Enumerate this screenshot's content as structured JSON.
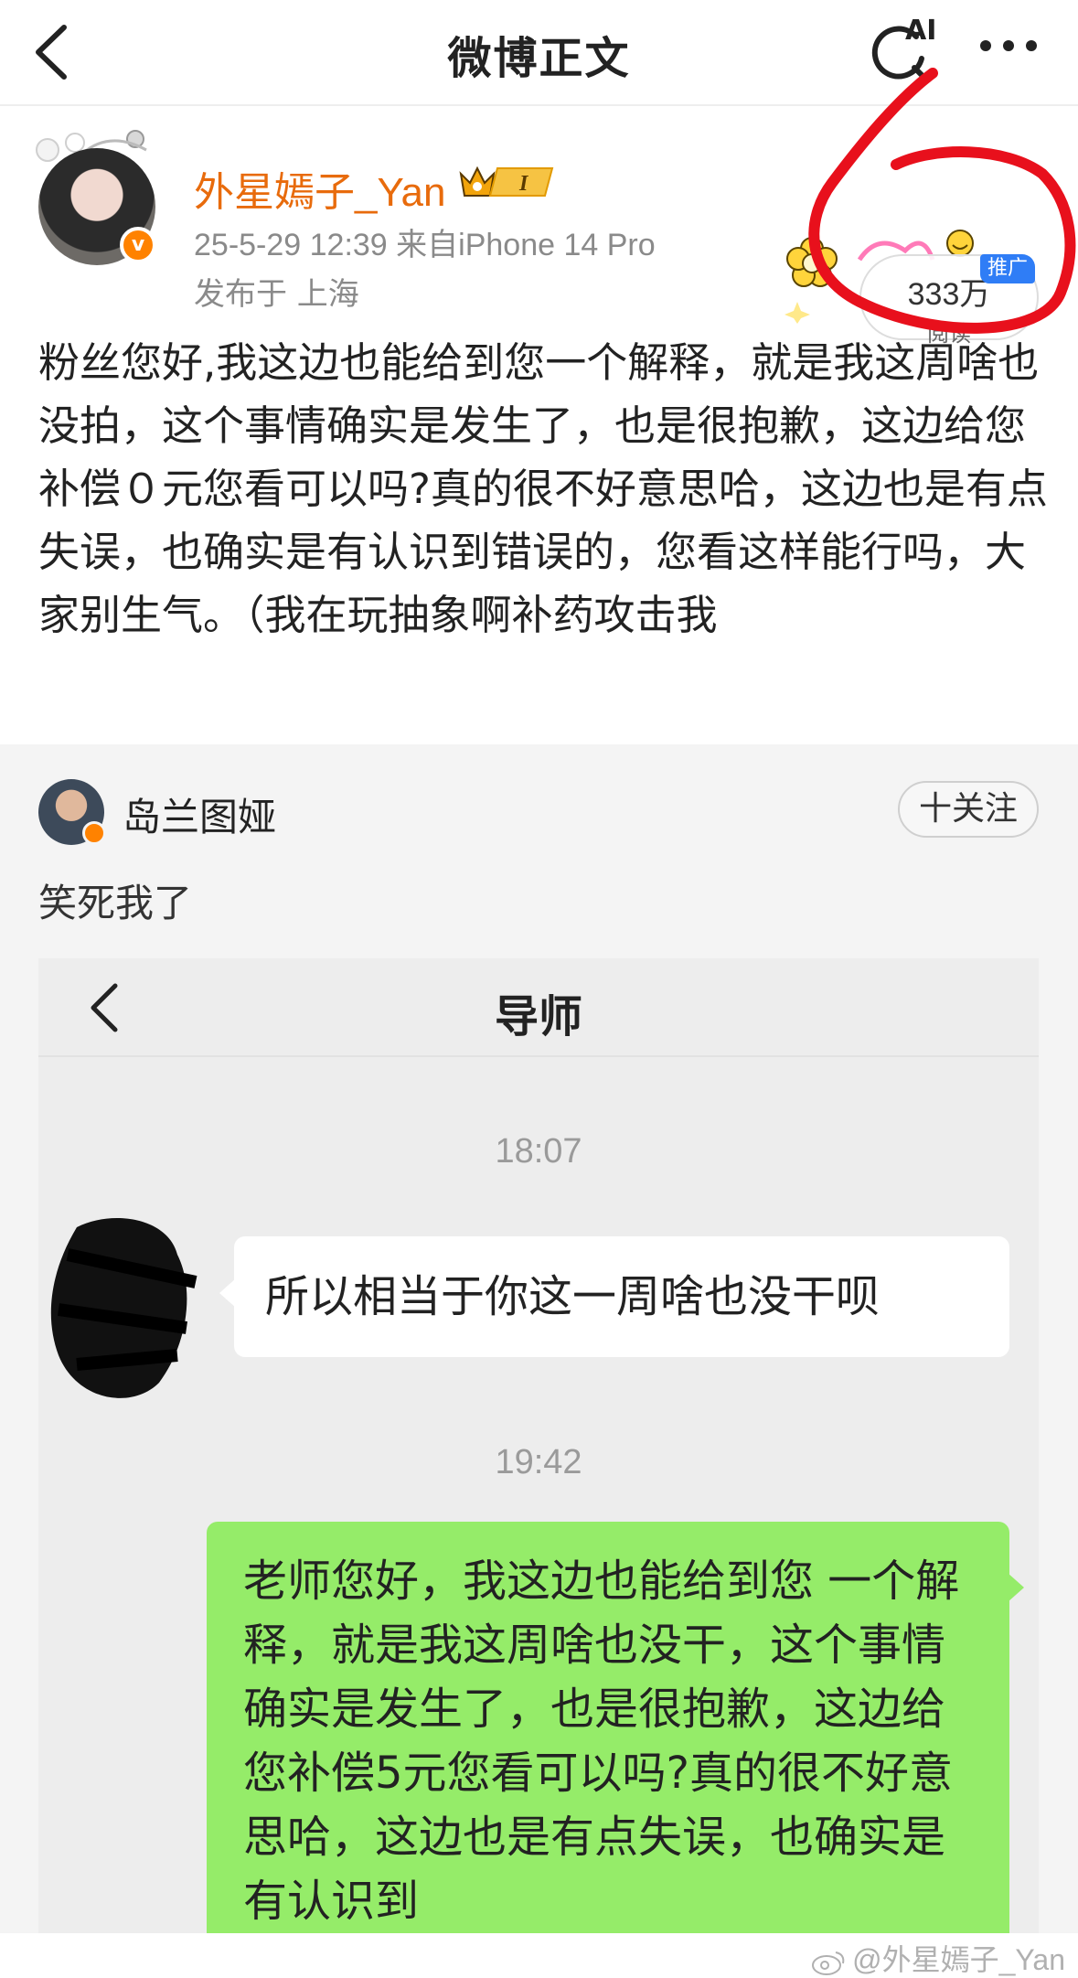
{
  "nav": {
    "title": "微博正文",
    "ai_label": "AI"
  },
  "post": {
    "username": "外星嫣子_Yan",
    "vip_level": "I",
    "meta": "25-5-29 12:39  来自iPhone 14 Pro",
    "location": "发布于 上海",
    "read_count": "333万",
    "read_label": "阅读",
    "promo_tag": "推广",
    "body": "粉丝您好,我这边也能给到您一个解释，就是我这周啥也没拍，这个事情确实是发生了，也是很抱歉，这边给您补偿０元您看可以吗?真的很不好意思哈，这边也是有点失误，也确实是有认识到错误的，您看这样能行吗，大家别生气。（我在玩抽象啊补药攻击我"
  },
  "repost": {
    "username": "岛兰图娅",
    "follow_label": "十关注",
    "text": "笑死我了",
    "chat": {
      "title": "导师",
      "time1": "18:07",
      "message1": "所以相当于你这一周啥也没干呗",
      "time2": "19:42",
      "message2": "老师您好，我这边也能给到您 一个解释，就是我这周啥也没干，这个事情确实是发生了，也是很抱歉，这边给您补偿5元您看可以吗?真的很不好意思哈，这边也是有点失误，也确实是有认识到"
    }
  },
  "watermark": "@外星嫣子_Yan",
  "colors": {
    "username": "#e86b0c",
    "verified": "#ff8200",
    "promo": "#2f7df6",
    "annotation": "#e8101c",
    "wechat_bubble": "#95ec69"
  }
}
